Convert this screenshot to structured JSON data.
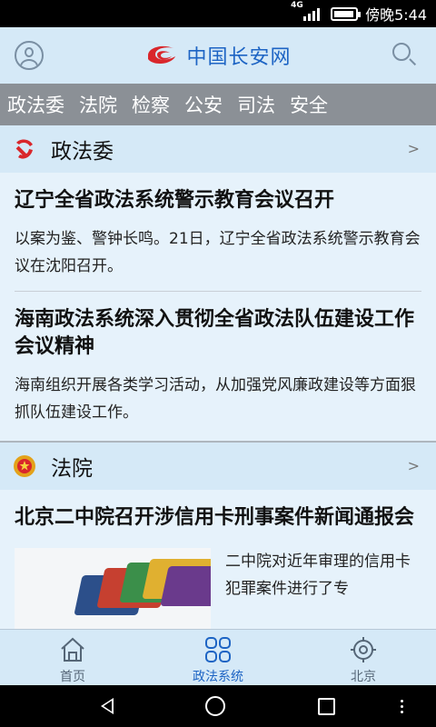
{
  "status": {
    "network": "4G",
    "battery_level": 0.8,
    "time": "傍晚5:44"
  },
  "header": {
    "brand": "中国长安网",
    "user_icon": "user-icon",
    "search_icon": "search-icon"
  },
  "categories": [
    "政法委",
    "法院",
    "检察",
    "公安",
    "司法",
    "安全"
  ],
  "sections": [
    {
      "title": "政法委",
      "icon": "party-emblem-icon",
      "chevron": ">",
      "articles": [
        {
          "title": "辽宁全省政法系统警示教育会议召开",
          "desc": "以案为鉴、警钟长鸣。21日，辽宁全省政法系统警示教育会议在沈阳召开。"
        },
        {
          "title": "海南政法系统深入贯彻全省政法队伍建设工作会议精神",
          "desc": "海南组织开展各类学习活动，从加强党风廉政建设等方面狠抓队伍建设工作。"
        }
      ]
    },
    {
      "title": "法院",
      "icon": "court-emblem-icon",
      "chevron": ">",
      "articles": [
        {
          "title": "北京二中院召开涉信用卡刑事案件新闻通报会",
          "desc": "二中院对近年审理的信用卡犯罪案件进行了专"
        }
      ]
    }
  ],
  "bottom_nav": [
    {
      "label": "首页",
      "icon": "home-icon",
      "active": false
    },
    {
      "label": "政法系统",
      "icon": "grid-icon",
      "active": true
    },
    {
      "label": "北京",
      "icon": "location-icon",
      "active": false
    }
  ],
  "colors": {
    "brand_blue": "#1d64c4",
    "brand_red": "#d9262b",
    "header_bg": "#d5e9f7",
    "category_bar": "#8b9096"
  }
}
